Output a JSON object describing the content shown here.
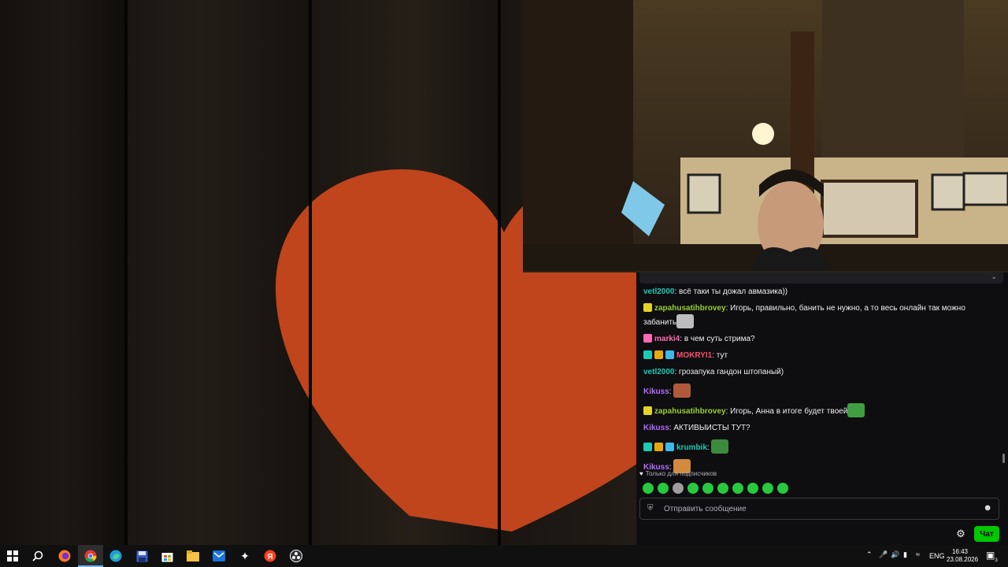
{
  "chat": {
    "messages": [
      {
        "badges": [],
        "user": "vetl2000",
        "color": "#1ec9b5",
        "text": "всё таки ты дожал авмазика))",
        "emote": false
      },
      {
        "badges": [
          "#e3d324"
        ],
        "user": "zapahusatihbrovey",
        "color": "#9acd32",
        "text": "Игорь, правильно, банить не нужно, а то весь онлайн так можно забанить",
        "emote": true,
        "emote_color": "#bdbdbd"
      },
      {
        "badges": [
          "#ff69b4"
        ],
        "user": "marki4",
        "color": "#ff69b4",
        "text": "в чем суть стрима?",
        "emote": false
      },
      {
        "badges": [
          "#1ec9b5",
          "#e8a80c",
          "#3fb9e8"
        ],
        "user": "MOKRYI1",
        "color": "#ff4f6e",
        "text": "тут",
        "emote": false
      },
      {
        "badges": [],
        "user": "vetl2000",
        "color": "#1ec9b5",
        "text": "грозапука гандон штопаный)",
        "emote": false
      },
      {
        "badges": [],
        "user": "Kikuss",
        "color": "#b46cff",
        "text": "",
        "emote": true,
        "emote_color": "#b05a3a"
      },
      {
        "badges": [
          "#e3d324"
        ],
        "user": "zapahusatihbrovey",
        "color": "#9acd32",
        "text": "Игорь, Анна в итоге будет твоей",
        "emote": true,
        "emote_color": "#3f9e3f"
      },
      {
        "badges": [],
        "user": "Kikuss",
        "color": "#b46cff",
        "text": "АКТИВЫИСТЫ ТУТ?",
        "emote": false
      },
      {
        "badges": [
          "#1ec9b5",
          "#e8a80c",
          "#3fb9e8"
        ],
        "user": "krumbik",
        "color": "#1ec9b5",
        "text": "",
        "emote": true,
        "emote_color": "#3c8a3c"
      },
      {
        "badges": [],
        "user": "Kikuss",
        "color": "#b46cff",
        "text": "",
        "emote": true,
        "emote_color": "#d28a3c"
      }
    ],
    "subs_only_label": "Только для подписчиков",
    "input_placeholder": "Отправить сообщение",
    "send_label": "Чат"
  },
  "taskbar": {
    "apps": [
      "start-icon",
      "search-icon",
      "firefox-icon",
      "chrome-icon",
      "edge-icon",
      "save-icon",
      "store-icon",
      "file-explorer-icon",
      "mail-icon",
      "sparkle-icon",
      "yandex-icon",
      "obs-icon"
    ],
    "lang": "ENG",
    "time": "16:43",
    "date": "23.08.2026",
    "notifications": "3"
  },
  "colors": {
    "chat_bg": "#0e0e10",
    "accent_green": "#00c800",
    "taskbar_bg": "#101010"
  }
}
